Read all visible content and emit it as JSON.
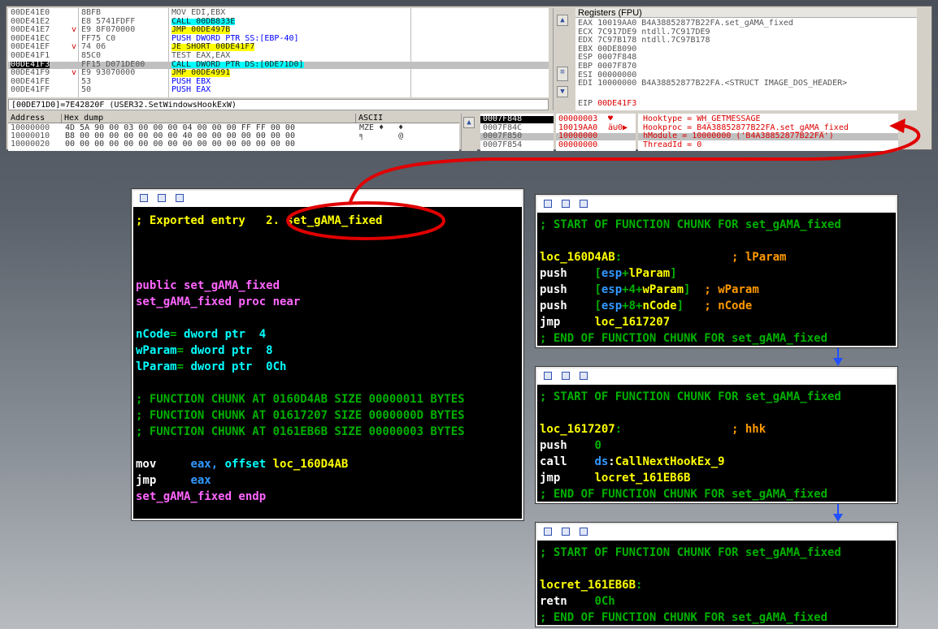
{
  "cpu": {
    "rows": [
      {
        "addr": "00DE41E0",
        "mark": "",
        "hex": "8BFB",
        "asm": "MOV EDI,EBX",
        "asm_style": "plain"
      },
      {
        "addr": "00DE41E2",
        "mark": "",
        "hex": "E8 5741FDFF",
        "asm": "CALL 00DB833E",
        "asm_style": "call"
      },
      {
        "addr": "00DE41E7",
        "mark": "v",
        "hex": "E9 8F070000",
        "asm": "JMP 00DE497B",
        "asm_style": "jmp"
      },
      {
        "addr": "00DE41EC",
        "mark": "",
        "hex": "FF75 C0",
        "asm": "PUSH DWORD PTR SS:[EBP-40]",
        "asm_style": "push"
      },
      {
        "addr": "00DE41EF",
        "mark": "v",
        "hex": "74 06",
        "asm": "JE SHORT 00DE41F7",
        "asm_style": "jmp"
      },
      {
        "addr": "00DE41F1",
        "mark": "",
        "hex": "85C0",
        "asm": "TEST EAX,EAX",
        "asm_style": "plain"
      },
      {
        "addr": "00DE41F3",
        "mark": "",
        "hex": "FF15 D071DE00",
        "asm": "CALL DWORD PTR DS:[0DE71D0]",
        "asm_style": "call"
      },
      {
        "addr": "00DE41F9",
        "mark": "v",
        "hex": "E9 93070000",
        "asm": "JMP 00DE4991",
        "asm_style": "jmp"
      },
      {
        "addr": "00DE41FE",
        "mark": "",
        "hex": "53",
        "asm": "PUSH EBX",
        "asm_style": "push"
      },
      {
        "addr": "00DE41FF",
        "mark": "",
        "hex": "50",
        "asm": "PUSH EAX",
        "asm_style": "push"
      }
    ],
    "selected_row": 6,
    "info": "[00DE71D0]=7E42820F (USER32.SetWindowsHookExW)"
  },
  "registers": {
    "title": "Registers (FPU)",
    "rows": [
      "EAX 10019AA0 B4A38852877B22FA.set_gAMA_fixed",
      "ECX 7C917DE9 ntdll.7C917DE9",
      "EDX 7C97B178 ntdll.7C97B178",
      "EBX 00DE8090",
      "ESP 0007F848",
      "EBP 0007F870",
      "ESI 00000000",
      "EDI 10000000 B4A38852877B22FA.<STRUCT IMAGE_DOS_HEADER>"
    ],
    "eip_label": "EIP",
    "eip_value": "00DE41F3"
  },
  "hexdump": {
    "col_address": "Address",
    "col_hex": "Hex dump",
    "col_ascii": "ASCII",
    "rows": [
      {
        "addr": "10000000",
        "hex": "4D 5A 90 00 03 00 00 00 04 00 00 00 FF FF 00 00",
        "ascii": "MZE ♦   ♦"
      },
      {
        "addr": "10000010",
        "hex": "B8 00 00 00 00 00 00 00 40 00 00 00 00 00 00 00",
        "ascii": "╕       @"
      },
      {
        "addr": "10000020",
        "hex": "00 00 00 00 00 00 00 00 00 00 00 00 00 00 00 00",
        "ascii": ""
      }
    ]
  },
  "stack": {
    "rows": [
      {
        "addr": "0007F848",
        "val": "00000003",
        "ascii": "♥",
        "comment": "Hooktype = WH_GETMESSAGE"
      },
      {
        "addr": "0007F84C",
        "val": "10019AA0",
        "ascii": "ä⊍0▶",
        "comment": "Hookproc = B4A38852877B22FA.set_gAMA_fixed"
      },
      {
        "addr": "0007F850",
        "val": "10000000",
        "ascii": "",
        "comment": "hModule = 10000000 ('B4A38852877B22FA')"
      },
      {
        "addr": "0007F854",
        "val": "00000000",
        "ascii": "",
        "comment": "ThreadId = 0"
      }
    ]
  },
  "idb_main": {
    "lines": [
      [
        {
          "t": "; Exported entry  ",
          "c": "y"
        },
        {
          "t": " 2. set_gAMA_fixed",
          "c": "y"
        }
      ],
      [],
      [],
      [],
      [
        {
          "t": "public set_gAMA_fixed",
          "c": "m"
        }
      ],
      [
        {
          "t": "set_gAMA_fixed proc near",
          "c": "m"
        }
      ],
      [],
      [
        {
          "t": "nCode",
          "c": "cy"
        },
        {
          "t": "= ",
          "c": "g"
        },
        {
          "t": "dword ptr  4",
          "c": "cy"
        }
      ],
      [
        {
          "t": "wParam",
          "c": "cy"
        },
        {
          "t": "= ",
          "c": "g"
        },
        {
          "t": "dword ptr  8",
          "c": "cy"
        }
      ],
      [
        {
          "t": "lParam",
          "c": "cy"
        },
        {
          "t": "= ",
          "c": "g"
        },
        {
          "t": "dword ptr  0Ch",
          "c": "cy"
        }
      ],
      [],
      [
        {
          "t": "; FUNCTION CHUNK AT 0160D4AB SIZE 00000011 BYTES",
          "c": "g"
        }
      ],
      [
        {
          "t": "; FUNCTION CHUNK AT 01617207 SIZE 0000000D BYTES",
          "c": "g"
        }
      ],
      [
        {
          "t": "; FUNCTION CHUNK AT 0161EB6B SIZE 00000003 BYTES",
          "c": "g"
        }
      ],
      [],
      [
        {
          "t": "mov     ",
          "c": "w"
        },
        {
          "t": "eax, ",
          "c": "bl"
        },
        {
          "t": "offset ",
          "c": "cy"
        },
        {
          "t": "loc_160D4AB",
          "c": "y"
        }
      ],
      [
        {
          "t": "jmp     ",
          "c": "w"
        },
        {
          "t": "eax",
          "c": "bl"
        }
      ],
      [
        {
          "t": "set_gAMA_fixed endp",
          "c": "m"
        }
      ]
    ]
  },
  "idb_chunk1": {
    "lines": [
      [
        {
          "t": "; START OF FUNCTION CHUNK FOR set_gAMA_fixed",
          "c": "g"
        }
      ],
      [],
      [
        {
          "t": "loc_160D4AB",
          "c": "y"
        },
        {
          "t": ":                ",
          "c": "g"
        },
        {
          "t": "; lParam",
          "c": "o"
        }
      ],
      [
        {
          "t": "push    ",
          "c": "w"
        },
        {
          "t": "[",
          "c": "g"
        },
        {
          "t": "esp",
          "c": "bl"
        },
        {
          "t": "+",
          "c": "g"
        },
        {
          "t": "lParam",
          "c": "y"
        },
        {
          "t": "]",
          "c": "g"
        }
      ],
      [
        {
          "t": "push    ",
          "c": "w"
        },
        {
          "t": "[",
          "c": "g"
        },
        {
          "t": "esp",
          "c": "bl"
        },
        {
          "t": "+4+",
          "c": "g"
        },
        {
          "t": "wParam",
          "c": "y"
        },
        {
          "t": "]  ",
          "c": "g"
        },
        {
          "t": "; wParam",
          "c": "o"
        }
      ],
      [
        {
          "t": "push    ",
          "c": "w"
        },
        {
          "t": "[",
          "c": "g"
        },
        {
          "t": "esp",
          "c": "bl"
        },
        {
          "t": "+8+",
          "c": "g"
        },
        {
          "t": "nCode",
          "c": "y"
        },
        {
          "t": "]   ",
          "c": "g"
        },
        {
          "t": "; nCode",
          "c": "o"
        }
      ],
      [
        {
          "t": "jmp     ",
          "c": "w"
        },
        {
          "t": "loc_1617207",
          "c": "y"
        }
      ],
      [
        {
          "t": "; END OF FUNCTION CHUNK FOR set_gAMA_fixed",
          "c": "g"
        }
      ]
    ]
  },
  "idb_chunk2": {
    "lines": [
      [
        {
          "t": "; START OF FUNCTION CHUNK FOR set_gAMA_fixed",
          "c": "g"
        }
      ],
      [],
      [
        {
          "t": "loc_1617207",
          "c": "y"
        },
        {
          "t": ":                ",
          "c": "g"
        },
        {
          "t": "; hhk",
          "c": "o"
        }
      ],
      [
        {
          "t": "push    ",
          "c": "w"
        },
        {
          "t": "0",
          "c": "g"
        }
      ],
      [
        {
          "t": "call    ",
          "c": "w"
        },
        {
          "t": "ds",
          "c": "bl"
        },
        {
          "t": ":",
          "c": "w"
        },
        {
          "t": "CallNextHookEx_9",
          "c": "y"
        }
      ],
      [
        {
          "t": "jmp     ",
          "c": "w"
        },
        {
          "t": "locret_161EB6B",
          "c": "y"
        }
      ],
      [
        {
          "t": "; END OF FUNCTION CHUNK FOR set_gAMA_fixed",
          "c": "g"
        }
      ]
    ]
  },
  "idb_chunk3": {
    "lines": [
      [
        {
          "t": "; START OF FUNCTION CHUNK FOR set_gAMA_fixed",
          "c": "g"
        }
      ],
      [],
      [
        {
          "t": "locret_161EB6B",
          "c": "y"
        },
        {
          "t": ":",
          "c": "g"
        }
      ],
      [
        {
          "t": "retn    ",
          "c": "w"
        },
        {
          "t": "0Ch",
          "c": "g"
        }
      ],
      [
        {
          "t": "; END OF FUNCTION CHUNK FOR set_gAMA_fixed",
          "c": "g"
        }
      ]
    ]
  },
  "colors": {
    "highlight_circle": "#e00000",
    "flow_arrow": "#0040ff"
  }
}
